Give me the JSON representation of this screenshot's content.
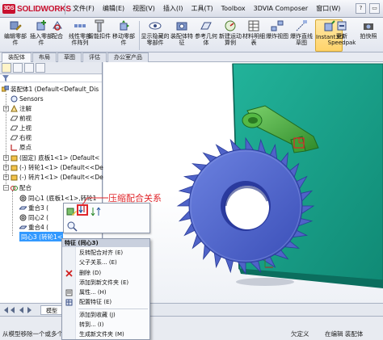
{
  "app": {
    "logo": "SOLIDWORKS"
  },
  "menu": [
    {
      "label": "文件(F)"
    },
    {
      "label": "编辑(E)"
    },
    {
      "label": "视图(V)"
    },
    {
      "label": "插入(I)"
    },
    {
      "label": "工具(T)"
    },
    {
      "label": "Toolbox"
    },
    {
      "label": "3DVIA Composer"
    },
    {
      "label": "窗口(W)"
    }
  ],
  "ribbon": [
    {
      "label": "编辑零部件",
      "icon": "edit-component-icon"
    },
    {
      "label": "插入零部件",
      "icon": "insert-components-icon"
    },
    {
      "label": "配合",
      "icon": "mate-icon"
    },
    {
      "label": "线性零部件阵列",
      "icon": "linear-pattern-icon"
    },
    {
      "label": "智能扣件",
      "icon": "smart-fasteners-icon"
    },
    {
      "label": "移动零部件",
      "icon": "move-component-icon"
    },
    {
      "label": "显示隐藏的零部件",
      "icon": "show-hidden-icon"
    },
    {
      "label": "装配体特征",
      "icon": "assembly-features-icon"
    },
    {
      "label": "参考几何体",
      "icon": "reference-geometry-icon"
    },
    {
      "label": "新建运动算例",
      "icon": "motion-study-icon"
    },
    {
      "label": "材料明细表",
      "icon": "bom-icon"
    },
    {
      "label": "爆炸视图",
      "icon": "exploded-view-icon"
    },
    {
      "label": "爆炸直线草图",
      "icon": "explode-line-icon"
    },
    {
      "label": "Instant3D",
      "icon": "instant3d-icon",
      "active": true
    },
    {
      "label": "更新Speedpak",
      "icon": "speedpak-icon"
    },
    {
      "label": "拍快照",
      "icon": "snapshot-icon"
    }
  ],
  "cm_tabs": [
    "装配体",
    "布局",
    "草图",
    "评估",
    "办公室产品"
  ],
  "tree": {
    "root": "装配体1 (Default<Default_Dis",
    "items": [
      "Sensors",
      "注解",
      "前视",
      "上视",
      "右视",
      "原点",
      "(固定) 底板1<1> (Default<",
      "(-) 转轮1<1> (Default<<Default",
      "(-) 转片1<1> (Default<<Defa",
      "配合",
      "同心1 (底板1<1>,转轮1",
      "重合3 (",
      "同心2 (",
      "重合4 (",
      "同心3 (转轮1<1>..."
    ]
  },
  "context_toolbar": {
    "callout": "压缩配合关系"
  },
  "context_menu": {
    "header": "特征 (同心3)",
    "items": [
      "反转配合对齐 (E)",
      "父子关系... (E)",
      "删除 (D)",
      "添加到新文件夹 (E)",
      "属性... (H)",
      "配置特征 (E)",
      "添加到收藏 (J)",
      "转到... (I)",
      "生成新文件夹 (M)"
    ]
  },
  "bottom": {
    "model_tab": "模型"
  },
  "status": {
    "left": "从模型移除一个或多个",
    "middle": "欠定义",
    "right1": "在编辑 装配体"
  },
  "colors": {
    "block": "#1aa58e",
    "wheel": "#5a6fd1",
    "arm": "#39a33a",
    "callout": "#e0262b",
    "selection": "#3399ff"
  }
}
